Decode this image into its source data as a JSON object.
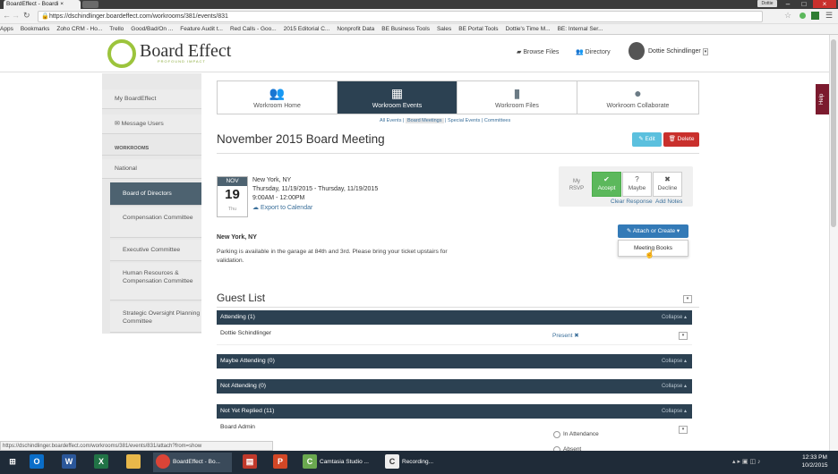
{
  "browser": {
    "tab_title": "BoardEffect - Boardi",
    "tab_close": "×",
    "user_chip": "Dottie",
    "url": "https://dschindlinger.boardeffect.com/workrooms/381/events/831",
    "bookmarks": [
      "Apps",
      "Bookmarks",
      "Zoho CRM - Ho...",
      "Trello",
      "Good/Bad/On ...",
      "Feature Audit t...",
      "Red Calls - Goo...",
      "2015 Editorial C...",
      "Nonprofit Data",
      "BE Business Tools",
      "Sales",
      "BE Portal Tools",
      "Dottie's Time M...",
      "BE: Internal Ser..."
    ],
    "status_url": "https://dschindlinger.boardeffect.com/workrooms/381/events/831/attach?from=show"
  },
  "header": {
    "logo_text": "Board Effect",
    "logo_sub": "PROFOUND IMPACT",
    "browse_files": "Browse Files",
    "directory": "Directory",
    "user_name": "Dottie Schindlinger"
  },
  "sidebar": {
    "my_boardeffect": "My BoardEffect",
    "message_users": "Message Users",
    "workrooms_heading": "WORKROOMS",
    "national": "National",
    "items": [
      "Board of Directors",
      "Compensation Committee",
      "Executive Committee",
      "Human Resources & Compensation Committee",
      "Strategic Oversight Planning Committee"
    ]
  },
  "tabs": [
    {
      "label": "Workroom Home",
      "icon": "users-icon"
    },
    {
      "label": "Workroom Events",
      "icon": "calendar-icon"
    },
    {
      "label": "Workroom Files",
      "icon": "files-icon"
    },
    {
      "label": "Workroom Collaborate",
      "icon": "chat-icon"
    }
  ],
  "subnav": [
    "All Events",
    "Board Meetings",
    "Special Events",
    "Committees"
  ],
  "event": {
    "title": "November 2015 Board Meeting",
    "edit": "Edit",
    "delete": "Delete",
    "month": "NOV",
    "day": "19",
    "weekday": "Thu",
    "location": "New York, NY",
    "dates": "Thursday, 11/19/2015 - Thursday, 11/19/2015",
    "times": "9:00AM - 12:00PM",
    "export": "Export to Calendar",
    "location_bold": "New York, NY",
    "description": "Parking is available in the garage at 84th and 3rd. Please bring your ticket upstairs for validation."
  },
  "rsvp": {
    "label": "My RSVP",
    "accept": "Accept",
    "maybe": "Maybe",
    "decline": "Decline",
    "clear": "Clear Response",
    "add_notes": "Add Notes"
  },
  "attach": {
    "button": "Attach or Create",
    "menu_item": "Meeting Books"
  },
  "guests": {
    "title": "Guest List",
    "collapse": "Collapse",
    "attending": "Attending (1)",
    "attendee": "Dottie Schindlinger",
    "present": "Present",
    "maybe": "Maybe Attending (0)",
    "not_attending": "Not Attending (0)",
    "not_replied": "Not Yet Replied (11)",
    "board_admin": "Board Admin",
    "in_attendance": "In Attendance",
    "absent": "Absent"
  },
  "help": "Help",
  "taskbar": {
    "items": [
      "BoardEffect - Bo...",
      "Camtasia Studio ...",
      "Recording..."
    ],
    "time": "12:33 PM",
    "date": "10/2/2015"
  }
}
